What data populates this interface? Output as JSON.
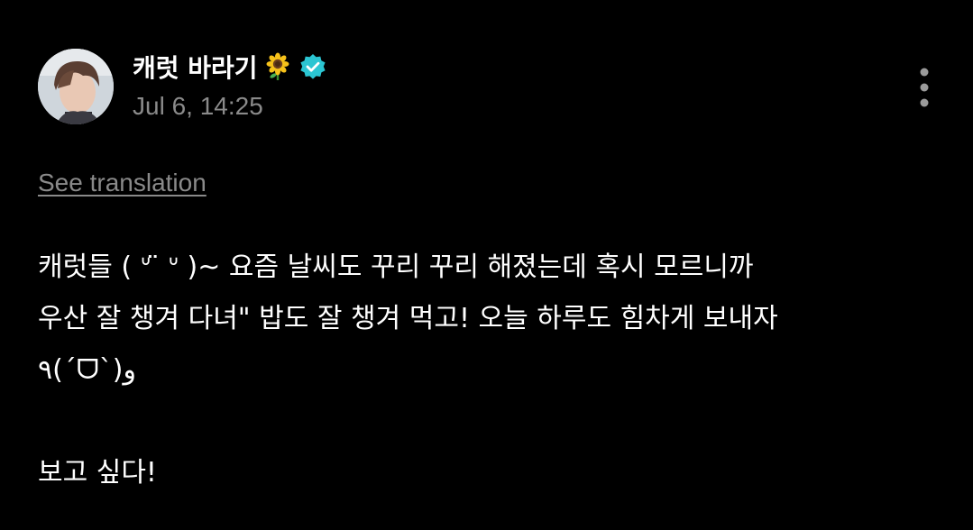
{
  "post": {
    "author": {
      "display_name": "캐럿 바라기",
      "name_emoji": "sunflower-emoji",
      "verified": true,
      "verified_icon": "verified-badge-icon",
      "verified_color": "#2bc5d2",
      "avatar_icon": "profile-photo"
    },
    "timestamp": "Jul 6, 14:25",
    "more_icon": "more-vertical-icon",
    "see_translation_label": "See translation",
    "body_lines": [
      "캐럿들 ( ᐡ ̈ ᐡ )~ 요즘 날씨도 꾸리 꾸리 해졌는데 혹시 모르니까",
      "우산 잘 챙겨 다녀\" 밥도 잘 챙겨 먹고! 오늘 하루도 힘차게 보내자",
      "٩(ˊᗜˋ)و",
      "보고 싶다!"
    ],
    "colors": {
      "background": "#000000",
      "text_primary": "#ffffff",
      "text_secondary": "#8a8a8a"
    }
  }
}
